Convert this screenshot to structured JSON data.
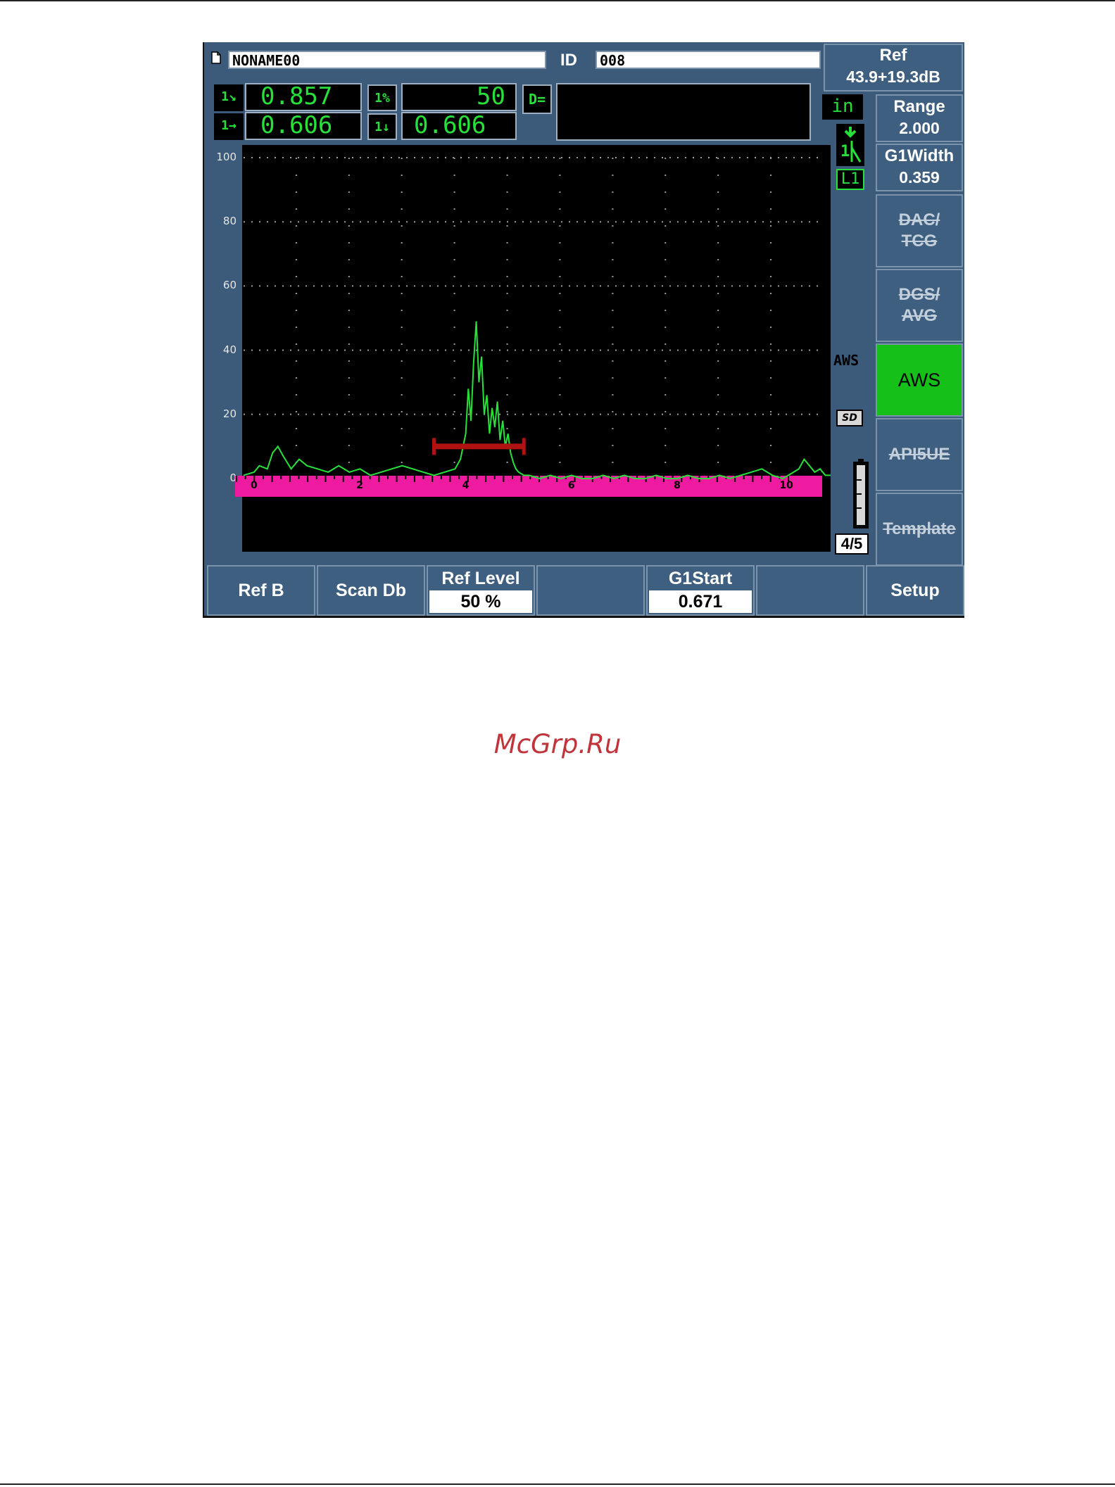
{
  "file": {
    "name": "NONAME00",
    "id_label": "ID",
    "id_value": "008"
  },
  "ref": {
    "label": "Ref",
    "value": "43.9+19.3dB"
  },
  "readings": {
    "r1_value": "0.857",
    "r2_value": "0.606",
    "r3_icon": "1%",
    "r3_value": "50",
    "r4_value": "0.606",
    "d_label": "D="
  },
  "units": "in",
  "side_status": {
    "mode_label": "AWS",
    "sd_label": "SD",
    "page_indicator": "4/5",
    "leg_label": "L1"
  },
  "right_menu": [
    {
      "label": "Range",
      "value": "2.000"
    },
    {
      "label": "G1Width",
      "value": "0.359"
    },
    {
      "line1": "DAC/",
      "line2": "TCG",
      "disabled": true
    },
    {
      "line1": "DGS/",
      "line2": "AVG",
      "disabled": true
    },
    {
      "line1": "AWS",
      "active": true
    },
    {
      "line1": "API5UE",
      "disabled": true
    },
    {
      "line1": "Template",
      "disabled": true
    }
  ],
  "bottom_menu": [
    {
      "label": "Ref B"
    },
    {
      "label": "Scan Db"
    },
    {
      "label": "Ref Level",
      "value": "50 %"
    },
    {
      "label": ""
    },
    {
      "label": "G1Start",
      "value": "0.671"
    },
    {
      "label": ""
    },
    {
      "label": "Setup"
    }
  ],
  "chart_data": {
    "type": "line",
    "y_ticks": [
      "100",
      "80",
      "60",
      "40",
      "20",
      "0"
    ],
    "x_ticks": [
      "0",
      "2",
      "4",
      "6",
      "8",
      "10"
    ],
    "ylim": [
      0,
      100
    ],
    "xlim": [
      -0.2,
      10.9
    ],
    "grid": true,
    "colors": {
      "trace": "#27e13a",
      "gate": "#b01212",
      "ruler": "#ee1aa0",
      "background": "#000000"
    },
    "gate": {
      "start": 3.4,
      "end": 5.1,
      "level": 10
    },
    "series": [
      {
        "x": [
          -0.2,
          0.0,
          0.1,
          0.25,
          0.35,
          0.45,
          0.55,
          0.7,
          0.85,
          1.0,
          1.2,
          1.4,
          1.6,
          1.8,
          2.0,
          2.2,
          2.4,
          2.6,
          2.8,
          3.0,
          3.2,
          3.4,
          3.6,
          3.8,
          3.9,
          4.0,
          4.05,
          4.1,
          4.15,
          4.2,
          4.25,
          4.3,
          4.35,
          4.4,
          4.45,
          4.5,
          4.55,
          4.6,
          4.65,
          4.7,
          4.75,
          4.8,
          4.85,
          4.9,
          4.95,
          5.0,
          5.1,
          5.2,
          5.4,
          5.6,
          5.8,
          6.0,
          6.2,
          6.4,
          6.6,
          6.8,
          7.0,
          7.2,
          7.4,
          7.6,
          7.8,
          8.0,
          8.2,
          8.4,
          8.6,
          8.8,
          9.0,
          9.2,
          9.4,
          9.6,
          9.8,
          10.0,
          10.1,
          10.2,
          10.3,
          10.4,
          10.5,
          10.6,
          10.7,
          10.8,
          10.9
        ],
        "y": [
          1,
          2,
          4,
          3,
          8,
          10,
          7,
          3,
          6,
          4,
          3,
          2,
          4,
          2,
          3,
          1,
          2,
          3,
          4,
          3,
          2,
          1,
          2,
          3,
          6,
          14,
          28,
          18,
          36,
          49,
          30,
          38,
          20,
          26,
          14,
          22,
          16,
          24,
          12,
          18,
          10,
          14,
          8,
          5,
          3,
          2,
          1,
          1,
          0,
          1,
          0,
          1,
          0,
          0,
          1,
          0,
          1,
          0,
          0,
          1,
          0,
          0,
          1,
          0,
          0,
          1,
          0,
          1,
          2,
          3,
          1,
          0,
          1,
          2,
          3,
          6,
          4,
          2,
          3,
          1,
          1
        ]
      }
    ]
  }
}
